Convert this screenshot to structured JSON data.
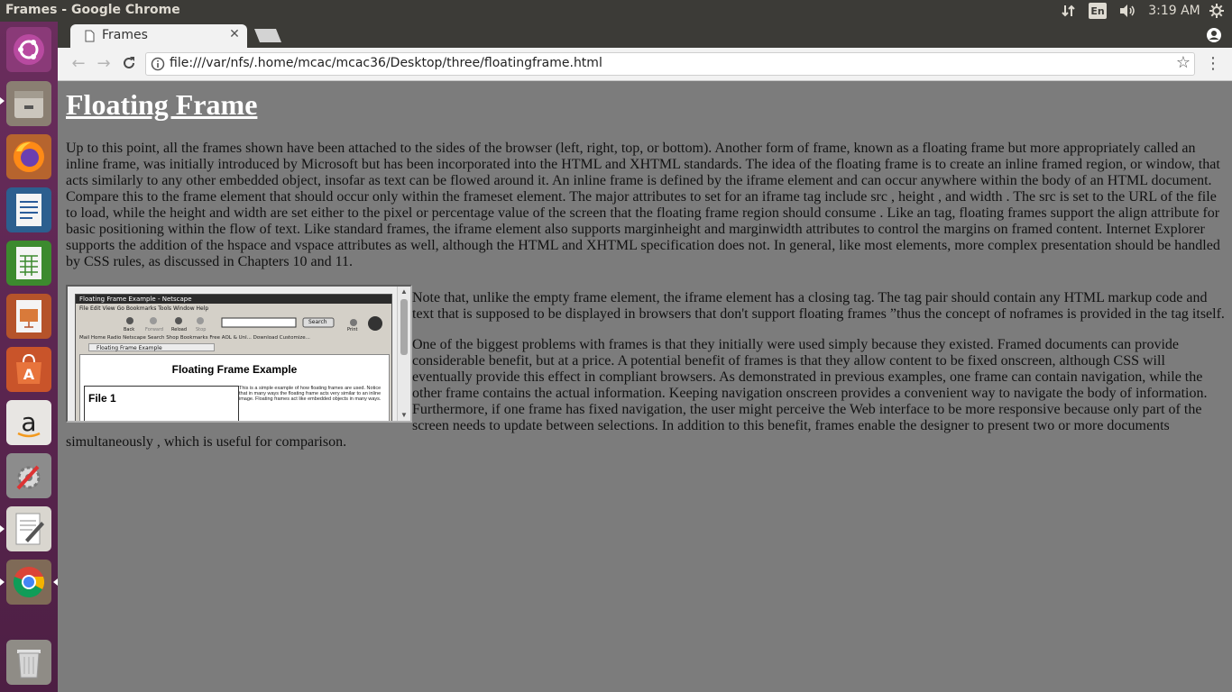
{
  "system": {
    "window_title": "Frames - Google Chrome",
    "input_language": "En",
    "clock": "3:19 AM",
    "network_icon": "network-arrows-icon",
    "volume_icon": "volume-icon",
    "settings_icon": "system-gear-icon"
  },
  "launcher": {
    "items": [
      {
        "name": "ubuntu-dash-icon"
      },
      {
        "name": "files-icon"
      },
      {
        "name": "firefox-icon"
      },
      {
        "name": "libreoffice-writer-icon"
      },
      {
        "name": "libreoffice-calc-icon"
      },
      {
        "name": "libreoffice-impress-icon"
      },
      {
        "name": "software-center-icon"
      },
      {
        "name": "amazon-icon"
      },
      {
        "name": "system-settings-icon"
      },
      {
        "name": "text-editor-icon"
      },
      {
        "name": "chrome-icon"
      },
      {
        "name": "trash-icon"
      }
    ]
  },
  "browser": {
    "tab_title": "Frames",
    "url": "file:///var/nfs/.home/mcac/mcac36/Desktop/three/floatingframe.html"
  },
  "page": {
    "heading": "Floating Frame",
    "para1": "Up to this point, all the frames shown have been attached to the sides of the browser (left, right, top, or bottom). Another form of frame, known as a floating frame but more appropriately called an inline frame, was initially introduced by Microsoft but has been incorporated into the HTML and XHTML standards. The idea of the floating frame is to create an inline framed region, or window, that acts similarly to any other embedded object, insofar as text can be flowed around it. An inline frame is defined by the iframe element and can occur anywhere within the body of an HTML document. Compare this to the frame element that should occur only within the frameset element. The major attributes to set for an iframe tag include src , height , and width . The src is set to the URL of the file to load, while the height and width are set either to the pixel or percentage value of the screen that the floating frame region should consume . Like an tag, floating frames support the align attribute for basic positioning within the flow of text. Like standard frames, the iframe element also supports marginheight and marginwidth attributes to control the margins on framed content. Internet Explorer supports the addition of the hspace and vspace attributes as well, although the HTML and XHTML specification does not. In general, like most elements, more complex presentation should be handled by CSS rules, as discussed in Chapters 10 and 11.",
    "para2": "Note that, unlike the empty frame element, the iframe element has a closing tag. The tag pair should contain any HTML markup code and text that is supposed to be displayed in browsers that don't support floating frames ”thus the concept of noframes is provided in the tag itself.",
    "para3": "One of the biggest problems with frames is that they initially were used simply because they existed. Framed documents can provide considerable benefit, but at a price. A potential benefit of frames is that they allow content to be fixed onscreen, although CSS will eventually provide this effect in compliant browsers. As demonstrated in previous examples, one frame can contain navigation, while the other frame contains the actual information. Keeping navigation onscreen provides a convenient way to navigate the body of information. Furthermore, if one frame has fixed navigation, the user might perceive the Web interface to be more responsive because only part of the screen needs to update between selections. In addition to this benefit, frames enable the designer to present two or more documents simultaneously , which is useful for comparison.",
    "iframe_image": {
      "window_title": "Floating Frame Example - Netscape",
      "menu": "File  Edit  View  Go  Bookmarks  Tools  Window  Help",
      "search_button": "Search",
      "nav_labels": [
        "Back",
        "Forward",
        "Reload",
        "Stop",
        "Print"
      ],
      "personal_bar": "Mail  Home  Radio  Netscape  Search  Shop    Bookmarks  Free AOL & Unl...  Download  Customize...",
      "tab": "Floating Frame Example",
      "heading": "Floating Frame Example",
      "file_label": "File 1",
      "side_text": "This is a simple example of how floating frames are used. Notice that in many ways the floating frame acts very similar to an inline image. Floating frames act like embedded objects in many ways."
    }
  }
}
